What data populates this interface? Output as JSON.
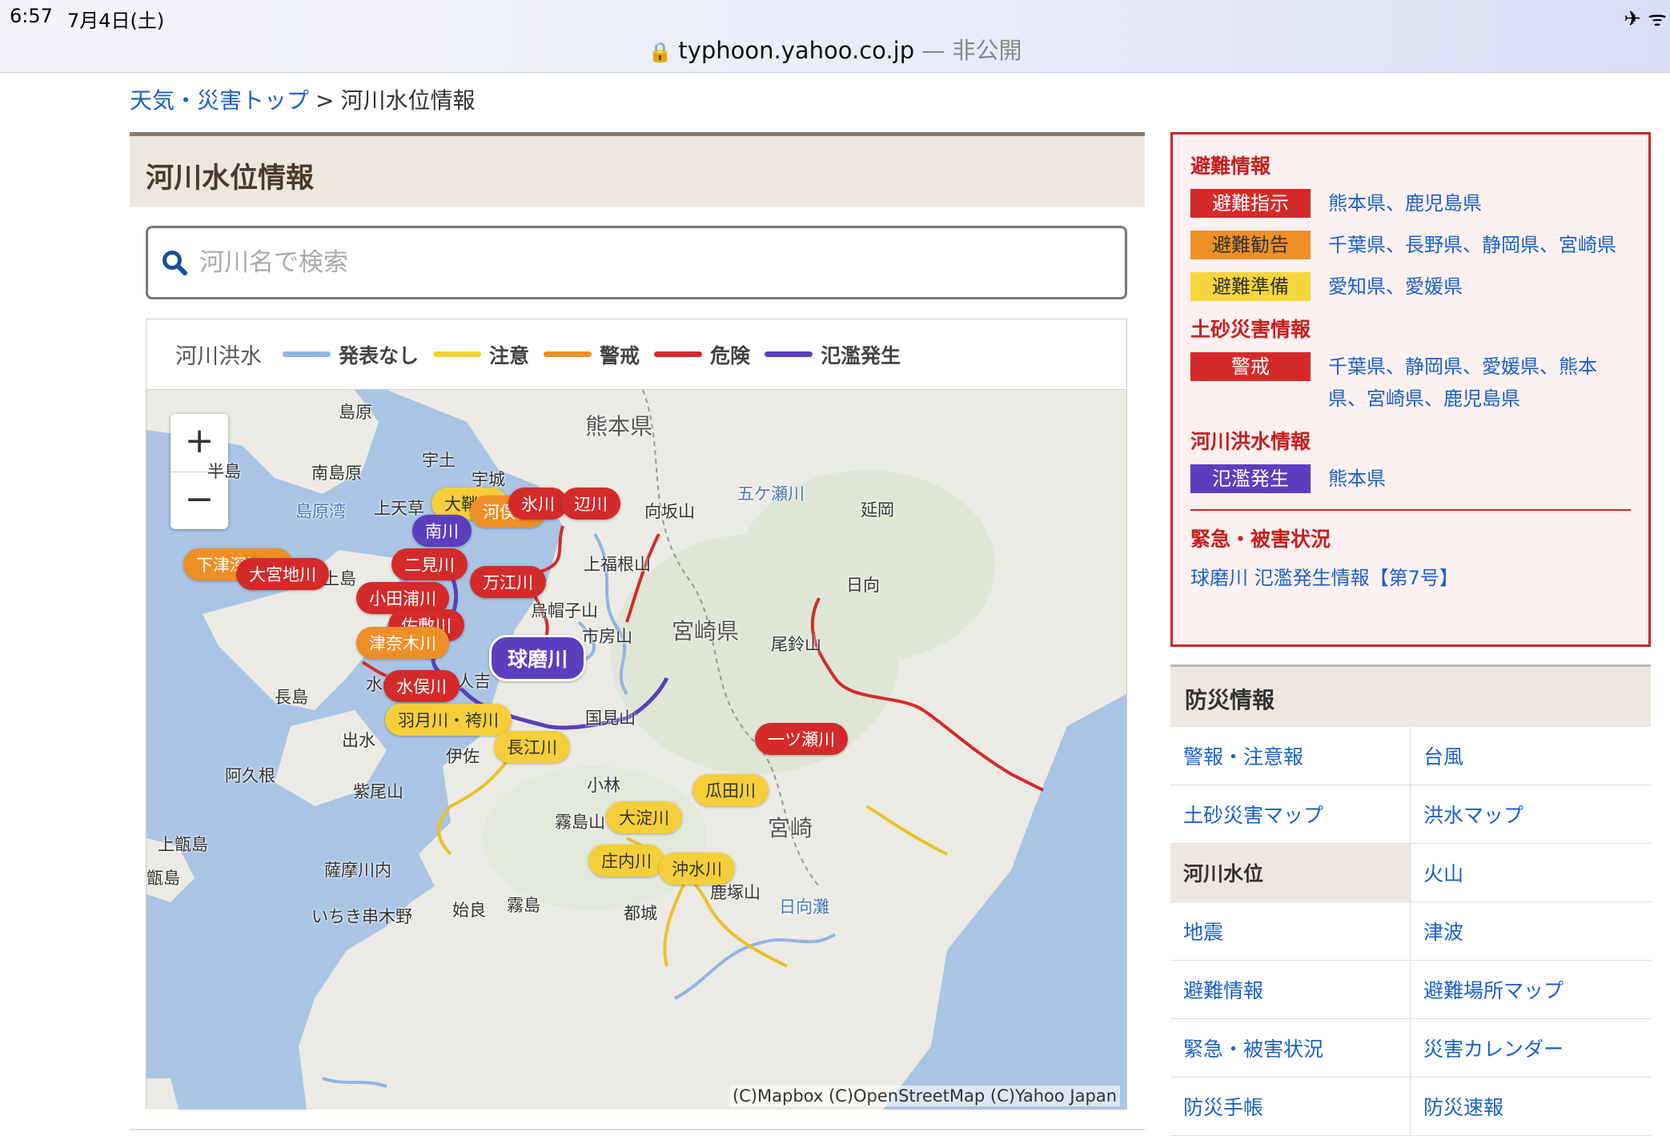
{
  "status": {
    "time": "6:57",
    "date": "7月4日(土)",
    "icons": "✈ ᯤ"
  },
  "url": {
    "domain": "typhoon.yahoo.co.jp",
    "suffix": "— 非公開"
  },
  "breadcrumb": {
    "top": "天気・災害トップ",
    "sep": ">",
    "current": "河川水位情報"
  },
  "panel": {
    "title": "河川水位情報"
  },
  "search": {
    "placeholder": "河川名で検索"
  },
  "legend": {
    "title": "河川洪水",
    "items": [
      {
        "label": "発表なし",
        "color": "#8fb4e6"
      },
      {
        "label": "注意",
        "color": "#f5cf3a"
      },
      {
        "label": "警戒",
        "color": "#ee8e27"
      },
      {
        "label": "危険",
        "color": "#d42a2a"
      },
      {
        "label": "氾濫発生",
        "color": "#5a3fbf"
      }
    ]
  },
  "map": {
    "zoom_in": "+",
    "zoom_out": "−",
    "attribution": "(C)Mapbox (C)OpenStreetMap (C)Yahoo Japan",
    "places": {
      "kumamoto_pref": "熊本県",
      "miyazaki_pref": "宮崎県",
      "shimabara": "島原",
      "minamishimabara": "南島原",
      "uto": "宇土",
      "uki": "宇城",
      "kamiamakusa": "上天草",
      "shimabarawan": "島原湾",
      "hantou": "半島",
      "kamishima": "上島",
      "mukaisakayama": "向坂山",
      "gokase": "五ケ瀬川",
      "nobeoka": "延岡",
      "hyuga": "日向",
      "kamifukune": "上福根山",
      "eboshi": "烏帽子山",
      "ichifusa": "市房山",
      "osuzu": "尾鈴山",
      "hitoyoshi": "人吉",
      "minamata": "水俣",
      "nagashima": "長島",
      "kunimi": "国見山",
      "izumi": "出水",
      "isa": "伊佐",
      "akune": "阿久根",
      "shibi": "紫尾山",
      "kobayashi": "小林",
      "kirishimayama": "霧島山",
      "miyazaki": "宮崎",
      "kamikoshiki": "上甑島",
      "koshiki": "甑島",
      "satsumasendai": "薩摩川内",
      "ichiki": "いちき串木野",
      "aira": "始良",
      "kirishima": "霧島",
      "kashima": "鹿塚山",
      "miyakonojo": "都城",
      "hyuganada": "日向灘"
    },
    "pins": {
      "kuma": "球磨川",
      "minami": "南川",
      "hikawa": "氷川",
      "henkawa": "辺川",
      "daisaku": "大鞘川",
      "kawamata": "河俣川",
      "futami": "二見川",
      "manko": "万江川",
      "shimotsufuka": "下津深江川",
      "omiyaji": "大宮地川",
      "kotaura": "小田浦川",
      "sashiki": "佐敷川",
      "tsunagi": "津奈木川",
      "minamata": "水俣川",
      "hazuki": "羽月川・袴川",
      "nagae": "長江川",
      "hitotsuse": "一ツ瀬川",
      "urita": "瓜田川",
      "oyodo": "大淀川",
      "shonai": "庄内川",
      "okimizu": "沖水川"
    }
  },
  "alert": {
    "evac_title": "避難情報",
    "evac": [
      {
        "badge": "避難指示",
        "areas": "熊本県、鹿児島県"
      },
      {
        "badge": "避難勧告",
        "areas": "千葉県、長野県、静岡県、宮崎県"
      },
      {
        "badge": "避難準備",
        "areas": "愛知県、愛媛県"
      }
    ],
    "sediment_title": "土砂災害情報",
    "sediment": {
      "badge": "警戒",
      "areas": "千葉県、静岡県、愛媛県、熊本県、宮崎県、鹿児島県"
    },
    "flood_title": "河川洪水情報",
    "flood": {
      "badge": "氾濫発生",
      "areas": "熊本県"
    },
    "damage_title": "緊急・被害状況",
    "damage_link": "球磨川 氾濫発生情報【第7号】"
  },
  "bousai": {
    "title": "防災情報",
    "items": [
      "警報・注意報",
      "台風",
      "土砂災害マップ",
      "洪水マップ",
      "河川水位",
      "火山",
      "地震",
      "津波",
      "避難情報",
      "避難場所マップ",
      "緊急・被害状況",
      "災害カレンダー",
      "防災手帳",
      "防災速報"
    ]
  }
}
